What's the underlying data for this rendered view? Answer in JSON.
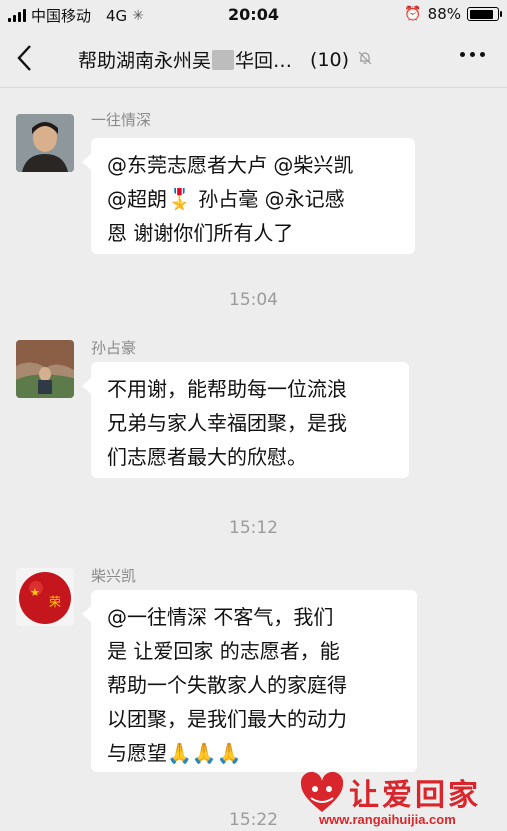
{
  "status_bar": {
    "carrier": "中国移动",
    "network": "4G",
    "time": "20:04",
    "battery_text": "88%",
    "battery_level": 0.88
  },
  "nav": {
    "back_icon": "chevron-left-icon",
    "title_part1": "帮助湖南永州吴",
    "title_part2": "华回…",
    "member_count": "(10)",
    "mute_icon": "bell-off-icon",
    "more_icon": "more-dots-icon"
  },
  "messages": [
    {
      "sender": "一往情深",
      "lines": [
        "@东莞志愿者大卢 @柴兴凯",
        "@超朗🎖️ 孙占毫 @永记感",
        "恩 谢谢你们所有人了"
      ]
    },
    {
      "time": "15:04",
      "sender": "孙占豪",
      "lines": [
        "不用谢，能帮助每一位流浪",
        "兄弟与家人幸福团聚，是我",
        "们志愿者最大的欣慰。"
      ]
    },
    {
      "time": "15:12",
      "sender": "柴兴凯",
      "lines": [
        "@一往情深  不客气，我们",
        "是 让爱回家 的志愿者，能",
        "帮助一个失散家人的家庭得",
        "以团聚，是我们最大的动力",
        "与愿望🙏🙏🙏"
      ]
    }
  ],
  "last_time": "15:22",
  "watermark": {
    "title": "让爱回家",
    "url": "www.rangaihuijia.com"
  },
  "colors": {
    "background": "#ededed",
    "bubble": "#ffffff",
    "watermark": "#d9262c"
  }
}
